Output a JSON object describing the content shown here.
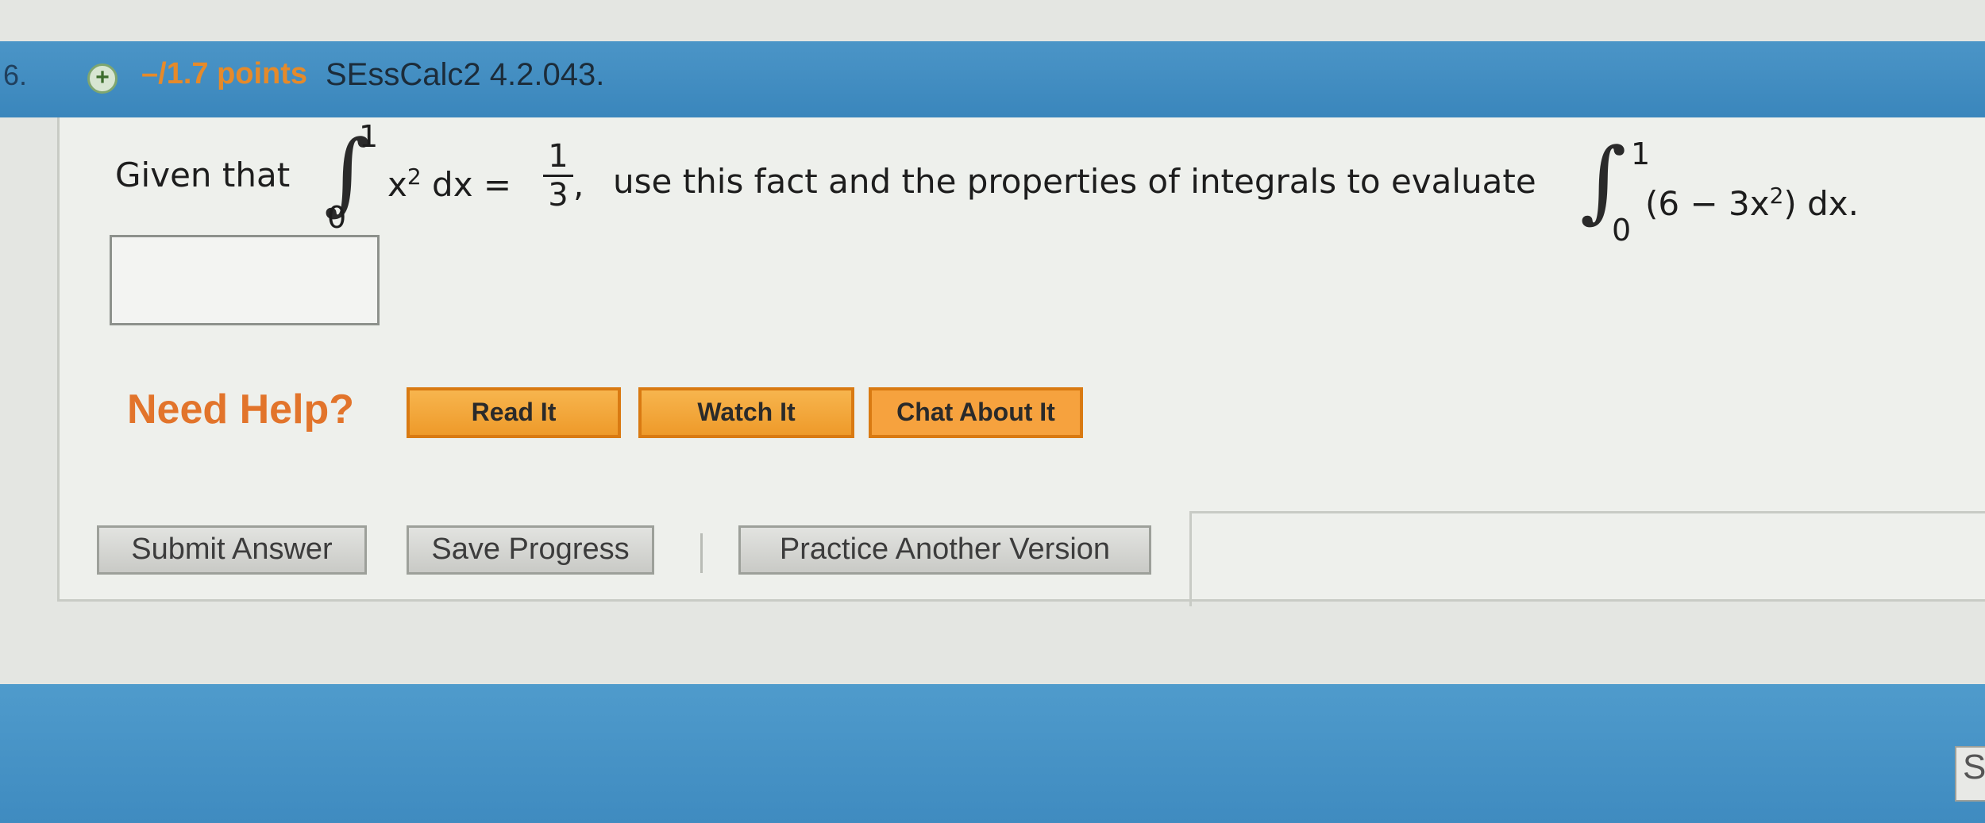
{
  "question": {
    "number": "6.",
    "points": "–/1.7 points",
    "id": "SEssCalc2 4.2.043."
  },
  "problem": {
    "given_label": "Given that",
    "integral1": {
      "upper": "1",
      "lower": "0",
      "integrand": "x",
      "exponent": "2",
      "dx": " dx =",
      "frac_num": "1",
      "frac_den": "3",
      "comma": ","
    },
    "middle_text": "use this fact and the properties of integrals to evaluate",
    "integral2": {
      "upper": "1",
      "lower": "0",
      "integrand_open": "(6 − 3x",
      "exponent": "2",
      "integrand_close": ") dx."
    }
  },
  "help": {
    "label": "Need Help?",
    "buttons": [
      "Read It",
      "Watch It",
      "Chat About It"
    ]
  },
  "actions": {
    "submit": "Submit Answer",
    "save": "Save Progress",
    "practice": "Practice Another Version"
  },
  "corner_label": "S",
  "colors": {
    "header_blue": "#3a86bc",
    "points_orange": "#e58a2a",
    "help_orange": "#ee9a2a"
  }
}
